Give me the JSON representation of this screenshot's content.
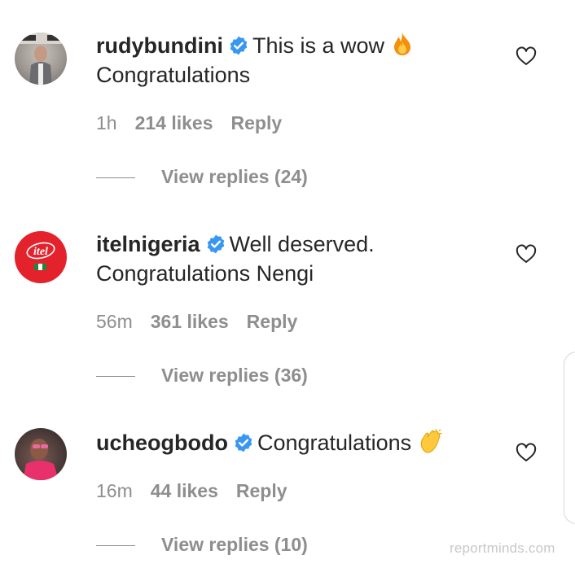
{
  "comments": [
    {
      "username": "rudybundini",
      "text_line1": "This is a wow",
      "text_line2": "Congratulations",
      "emoji": "fire-emoji",
      "time": "1h",
      "likes": "214 likes",
      "reply_label": "Reply",
      "view_replies": "View replies (24)"
    },
    {
      "username": "itelnigeria",
      "text_line1": "Well deserved.",
      "text_line2": "Congratulations Nengi",
      "avatar_text": "itel",
      "time": "56m",
      "likes": "361 likes",
      "reply_label": "Reply",
      "view_replies": "View replies (36)"
    },
    {
      "username": "ucheogbodo",
      "text_line1": "Congratulations",
      "emoji": "clapping-hands-emoji",
      "time": "16m",
      "likes": "44 likes",
      "reply_label": "Reply",
      "view_replies": "View replies (10)"
    }
  ],
  "watermark": "reportminds.com",
  "colors": {
    "verified_blue": "#3897f0",
    "meta_gray": "#8e8e8e",
    "text": "#262626",
    "itel_red": "#e4222b"
  }
}
